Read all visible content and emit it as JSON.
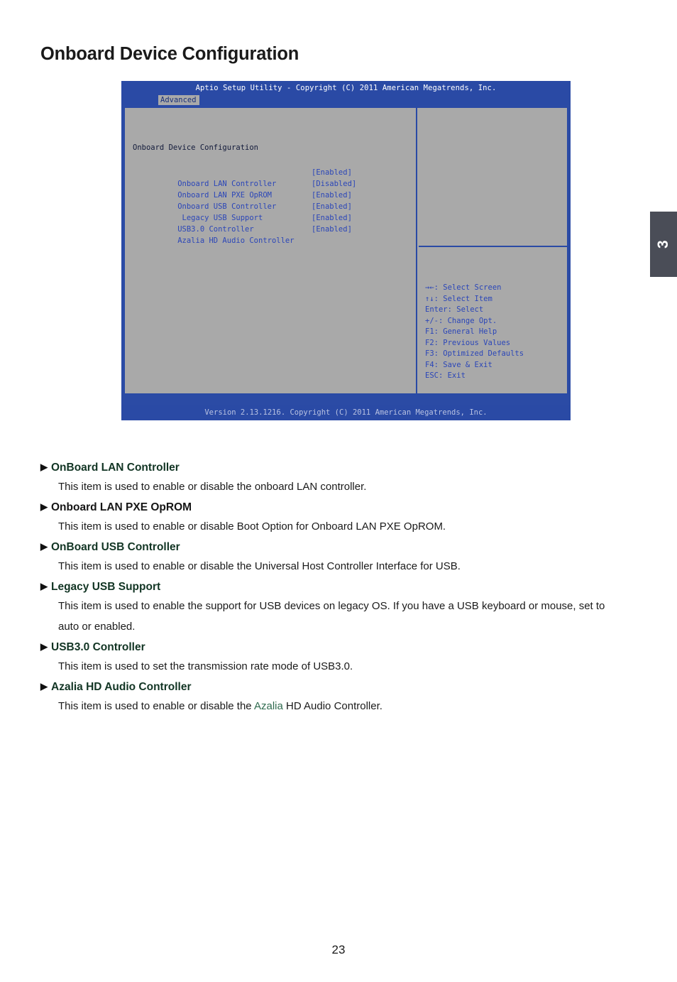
{
  "page": {
    "title": "Onboard Device Configuration",
    "number": "23",
    "chapter": "3"
  },
  "bios": {
    "titlebar": "Aptio Setup Utility - Copyright (C) 2011 American Megatrends, Inc.",
    "active_tab": "Advanced",
    "section_title": "Onboard Device Configuration",
    "items": [
      {
        "label": "Onboard LAN Controller",
        "value": "[Enabled]"
      },
      {
        "label": "Onboard LAN PXE OpROM",
        "value": "[Disabled]"
      },
      {
        "label": "Onboard USB Controller",
        "value": "[Enabled]"
      },
      {
        "label": " Legacy USB Support",
        "value": "[Enabled]"
      },
      {
        "label": "USB3.0 Controller",
        "value": "[Enabled]"
      },
      {
        "label": "Azalia HD Audio Controller",
        "value": "[Enabled]"
      }
    ],
    "key_legend": [
      "→←: Select Screen",
      "↑↓: Select Item",
      "Enter: Select",
      "+/-: Change Opt.",
      "F1: General Help",
      "F2: Previous Values",
      "F3: Optimized Defaults",
      "F4: Save & Exit",
      "ESC: Exit"
    ],
    "footer": "Version 2.13.1216. Copyright (C) 2011 American Megatrends, Inc."
  },
  "descriptions": [
    {
      "heading": "OnBoard LAN Controller",
      "heading_style": "green",
      "body_pre": "This item is used to enable or disable the onboard LAN controller.",
      "body_hl": "",
      "body_post": ""
    },
    {
      "heading": "Onboard LAN PXE OpROM",
      "heading_style": "plain",
      "body_pre": "This item is used to enable or disable Boot Option for Onboard LAN PXE OpROM.",
      "body_hl": "",
      "body_post": ""
    },
    {
      "heading": "OnBoard USB Controller",
      "heading_style": "green",
      "body_pre": "This item is used to enable or disable the Universal Host Controller Interface for USB.",
      "body_hl": "",
      "body_post": ""
    },
    {
      "heading": "Legacy USB Support",
      "heading_style": "green",
      "body_pre": "This item is used to enable the support for USB devices on legacy OS. If you have a USB keyboard or mouse, set to auto or enabled.",
      "body_hl": "",
      "body_post": ""
    },
    {
      "heading": "USB3.0 Controller",
      "heading_style": "green",
      "body_pre": "This item is used to set the transmission rate mode of USB3.0.",
      "body_hl": "",
      "body_post": ""
    },
    {
      "heading": "Azalia HD Audio Controller",
      "heading_style": "green",
      "body_pre": "This item is used to enable or disable the ",
      "body_hl": "Azalia",
      "body_post": " HD Audio Controller."
    }
  ],
  "colors": {
    "bios_blue": "#2a4aa5",
    "bios_gray": "#a9a9a9",
    "bios_text_blue": "#2b46b8",
    "heading_green": "#123524",
    "chapter_tab": "#4a4d57"
  },
  "bullet_glyph": "▶"
}
